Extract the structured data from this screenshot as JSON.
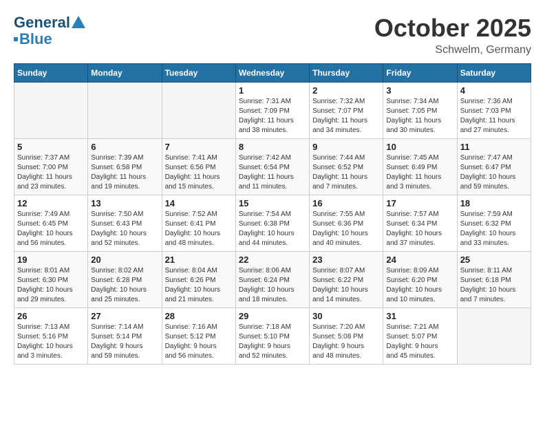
{
  "header": {
    "logo_line1": "General",
    "logo_line2": "Blue",
    "month": "October 2025",
    "location": "Schwelm, Germany"
  },
  "weekdays": [
    "Sunday",
    "Monday",
    "Tuesday",
    "Wednesday",
    "Thursday",
    "Friday",
    "Saturday"
  ],
  "weeks": [
    [
      {
        "day": "",
        "info": "",
        "empty": true
      },
      {
        "day": "",
        "info": "",
        "empty": true
      },
      {
        "day": "",
        "info": "",
        "empty": true
      },
      {
        "day": "1",
        "info": "Sunrise: 7:31 AM\nSunset: 7:09 PM\nDaylight: 11 hours\nand 38 minutes.",
        "empty": false
      },
      {
        "day": "2",
        "info": "Sunrise: 7:32 AM\nSunset: 7:07 PM\nDaylight: 11 hours\nand 34 minutes.",
        "empty": false
      },
      {
        "day": "3",
        "info": "Sunrise: 7:34 AM\nSunset: 7:05 PM\nDaylight: 11 hours\nand 30 minutes.",
        "empty": false
      },
      {
        "day": "4",
        "info": "Sunrise: 7:36 AM\nSunset: 7:03 PM\nDaylight: 11 hours\nand 27 minutes.",
        "empty": false
      }
    ],
    [
      {
        "day": "5",
        "info": "Sunrise: 7:37 AM\nSunset: 7:00 PM\nDaylight: 11 hours\nand 23 minutes.",
        "empty": false
      },
      {
        "day": "6",
        "info": "Sunrise: 7:39 AM\nSunset: 6:58 PM\nDaylight: 11 hours\nand 19 minutes.",
        "empty": false
      },
      {
        "day": "7",
        "info": "Sunrise: 7:41 AM\nSunset: 6:56 PM\nDaylight: 11 hours\nand 15 minutes.",
        "empty": false
      },
      {
        "day": "8",
        "info": "Sunrise: 7:42 AM\nSunset: 6:54 PM\nDaylight: 11 hours\nand 11 minutes.",
        "empty": false
      },
      {
        "day": "9",
        "info": "Sunrise: 7:44 AM\nSunset: 6:52 PM\nDaylight: 11 hours\nand 7 minutes.",
        "empty": false
      },
      {
        "day": "10",
        "info": "Sunrise: 7:45 AM\nSunset: 6:49 PM\nDaylight: 11 hours\nand 3 minutes.",
        "empty": false
      },
      {
        "day": "11",
        "info": "Sunrise: 7:47 AM\nSunset: 6:47 PM\nDaylight: 10 hours\nand 59 minutes.",
        "empty": false
      }
    ],
    [
      {
        "day": "12",
        "info": "Sunrise: 7:49 AM\nSunset: 6:45 PM\nDaylight: 10 hours\nand 56 minutes.",
        "empty": false
      },
      {
        "day": "13",
        "info": "Sunrise: 7:50 AM\nSunset: 6:43 PM\nDaylight: 10 hours\nand 52 minutes.",
        "empty": false
      },
      {
        "day": "14",
        "info": "Sunrise: 7:52 AM\nSunset: 6:41 PM\nDaylight: 10 hours\nand 48 minutes.",
        "empty": false
      },
      {
        "day": "15",
        "info": "Sunrise: 7:54 AM\nSunset: 6:38 PM\nDaylight: 10 hours\nand 44 minutes.",
        "empty": false
      },
      {
        "day": "16",
        "info": "Sunrise: 7:55 AM\nSunset: 6:36 PM\nDaylight: 10 hours\nand 40 minutes.",
        "empty": false
      },
      {
        "day": "17",
        "info": "Sunrise: 7:57 AM\nSunset: 6:34 PM\nDaylight: 10 hours\nand 37 minutes.",
        "empty": false
      },
      {
        "day": "18",
        "info": "Sunrise: 7:59 AM\nSunset: 6:32 PM\nDaylight: 10 hours\nand 33 minutes.",
        "empty": false
      }
    ],
    [
      {
        "day": "19",
        "info": "Sunrise: 8:01 AM\nSunset: 6:30 PM\nDaylight: 10 hours\nand 29 minutes.",
        "empty": false
      },
      {
        "day": "20",
        "info": "Sunrise: 8:02 AM\nSunset: 6:28 PM\nDaylight: 10 hours\nand 25 minutes.",
        "empty": false
      },
      {
        "day": "21",
        "info": "Sunrise: 8:04 AM\nSunset: 6:26 PM\nDaylight: 10 hours\nand 21 minutes.",
        "empty": false
      },
      {
        "day": "22",
        "info": "Sunrise: 8:06 AM\nSunset: 6:24 PM\nDaylight: 10 hours\nand 18 minutes.",
        "empty": false
      },
      {
        "day": "23",
        "info": "Sunrise: 8:07 AM\nSunset: 6:22 PM\nDaylight: 10 hours\nand 14 minutes.",
        "empty": false
      },
      {
        "day": "24",
        "info": "Sunrise: 8:09 AM\nSunset: 6:20 PM\nDaylight: 10 hours\nand 10 minutes.",
        "empty": false
      },
      {
        "day": "25",
        "info": "Sunrise: 8:11 AM\nSunset: 6:18 PM\nDaylight: 10 hours\nand 7 minutes.",
        "empty": false
      }
    ],
    [
      {
        "day": "26",
        "info": "Sunrise: 7:13 AM\nSunset: 5:16 PM\nDaylight: 10 hours\nand 3 minutes.",
        "empty": false
      },
      {
        "day": "27",
        "info": "Sunrise: 7:14 AM\nSunset: 5:14 PM\nDaylight: 9 hours\nand 59 minutes.",
        "empty": false
      },
      {
        "day": "28",
        "info": "Sunrise: 7:16 AM\nSunset: 5:12 PM\nDaylight: 9 hours\nand 56 minutes.",
        "empty": false
      },
      {
        "day": "29",
        "info": "Sunrise: 7:18 AM\nSunset: 5:10 PM\nDaylight: 9 hours\nand 52 minutes.",
        "empty": false
      },
      {
        "day": "30",
        "info": "Sunrise: 7:20 AM\nSunset: 5:08 PM\nDaylight: 9 hours\nand 48 minutes.",
        "empty": false
      },
      {
        "day": "31",
        "info": "Sunrise: 7:21 AM\nSunset: 5:07 PM\nDaylight: 9 hours\nand 45 minutes.",
        "empty": false
      },
      {
        "day": "",
        "info": "",
        "empty": true
      }
    ]
  ]
}
